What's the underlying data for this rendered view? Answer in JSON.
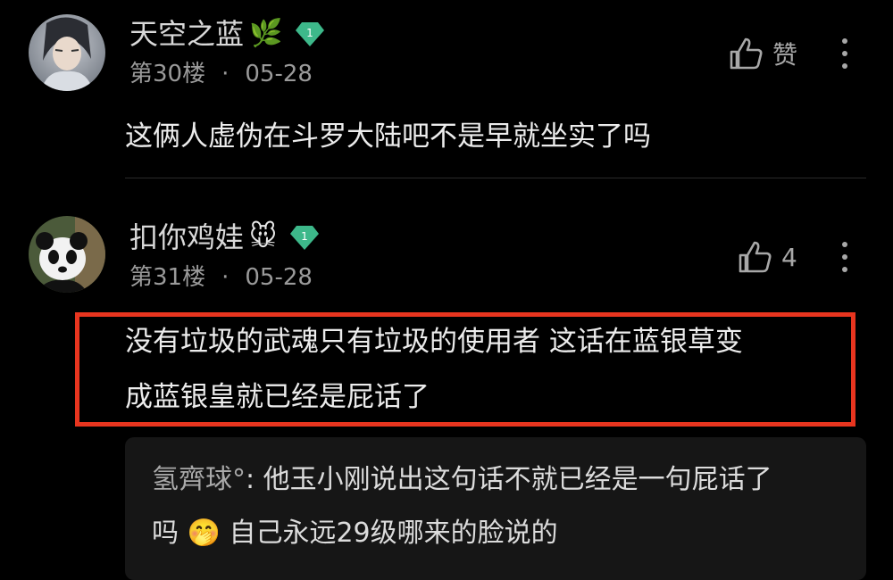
{
  "comments": [
    {
      "username": "天空之蓝",
      "username_emoji": "🌿",
      "level": "1",
      "floor": "第30楼",
      "date": "05-28",
      "like_label": "赞",
      "body": "这俩人虚伪在斗罗大陆吧不是早就坐实了吗"
    },
    {
      "username": "扣你鸡娃",
      "username_emoji": "🐭",
      "level": "1",
      "floor": "第31楼",
      "date": "05-28",
      "like_count": "4",
      "body_line1": "没有垃圾的武魂只有垃圾的使用者 这话在蓝银草变",
      "body_line2": "成蓝银皇就已经是屁话了",
      "reply": {
        "author": "氢齊球°",
        "separator": ": ",
        "line1": "他玉小刚说出这句话不就已经是一句屁话了",
        "line2_start": "吗 ",
        "emoji": "🤭",
        "line2_end": " 自己永远29级哪来的脸说的"
      }
    }
  ],
  "meta_separator": "·",
  "colors": {
    "background": "#000000",
    "highlight_border": "#e8351f",
    "level_badge": "#3db88a",
    "reply_background": "#161616"
  },
  "icons": {
    "like": "thumbs-up-icon",
    "more": "more-vertical-icon",
    "level": "diamond-level-icon"
  }
}
